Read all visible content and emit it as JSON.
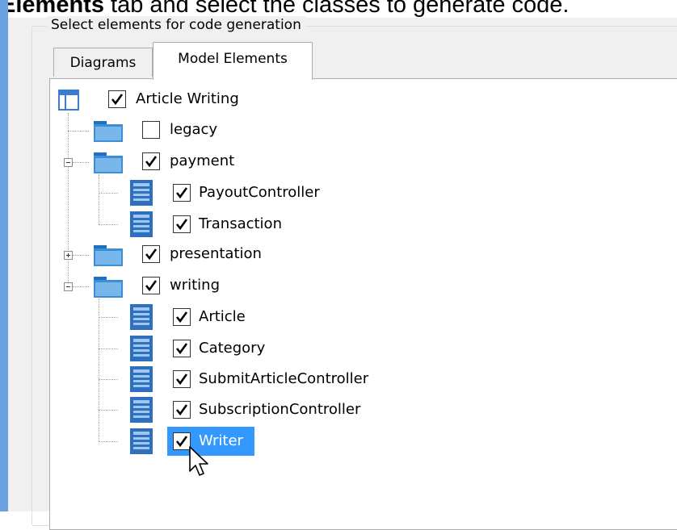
{
  "instruction": {
    "bold": "Elements",
    "rest": " tab and select the classes to generate code."
  },
  "group": {
    "title": "Select elements for code generation"
  },
  "tabs": [
    {
      "label": "Diagrams",
      "active": false
    },
    {
      "label": "Model Elements",
      "active": true
    }
  ],
  "tree": {
    "root": {
      "label": "Article Writing",
      "checked": true
    },
    "items": [
      {
        "label": "legacy",
        "type": "package",
        "checked": false
      },
      {
        "label": "payment",
        "type": "package",
        "checked": true,
        "expanded": true
      },
      {
        "label": "PayoutController",
        "type": "class",
        "checked": true
      },
      {
        "label": "Transaction",
        "type": "class",
        "checked": true
      },
      {
        "label": "presentation",
        "type": "package",
        "checked": true,
        "expanded": false
      },
      {
        "label": "writing",
        "type": "package",
        "checked": true,
        "expanded": true
      },
      {
        "label": "Article",
        "type": "class",
        "checked": true
      },
      {
        "label": "Category",
        "type": "class",
        "checked": true
      },
      {
        "label": "SubmitArticleController",
        "type": "class",
        "checked": true
      },
      {
        "label": "SubscriptionController",
        "type": "class",
        "checked": true
      },
      {
        "label": "Writer",
        "type": "class",
        "checked": true,
        "selected": true
      }
    ]
  },
  "colors": {
    "accent_bar": "#6aa1e3",
    "selection": "#3399ff",
    "package_icon": "#3a8fd8",
    "class_icon": "#2f6fbf"
  },
  "icons": {
    "root": "model-icon",
    "package": "package-folder-icon",
    "class": "class-icon",
    "check": "check-icon",
    "cursor": "mouse-pointer-icon"
  }
}
